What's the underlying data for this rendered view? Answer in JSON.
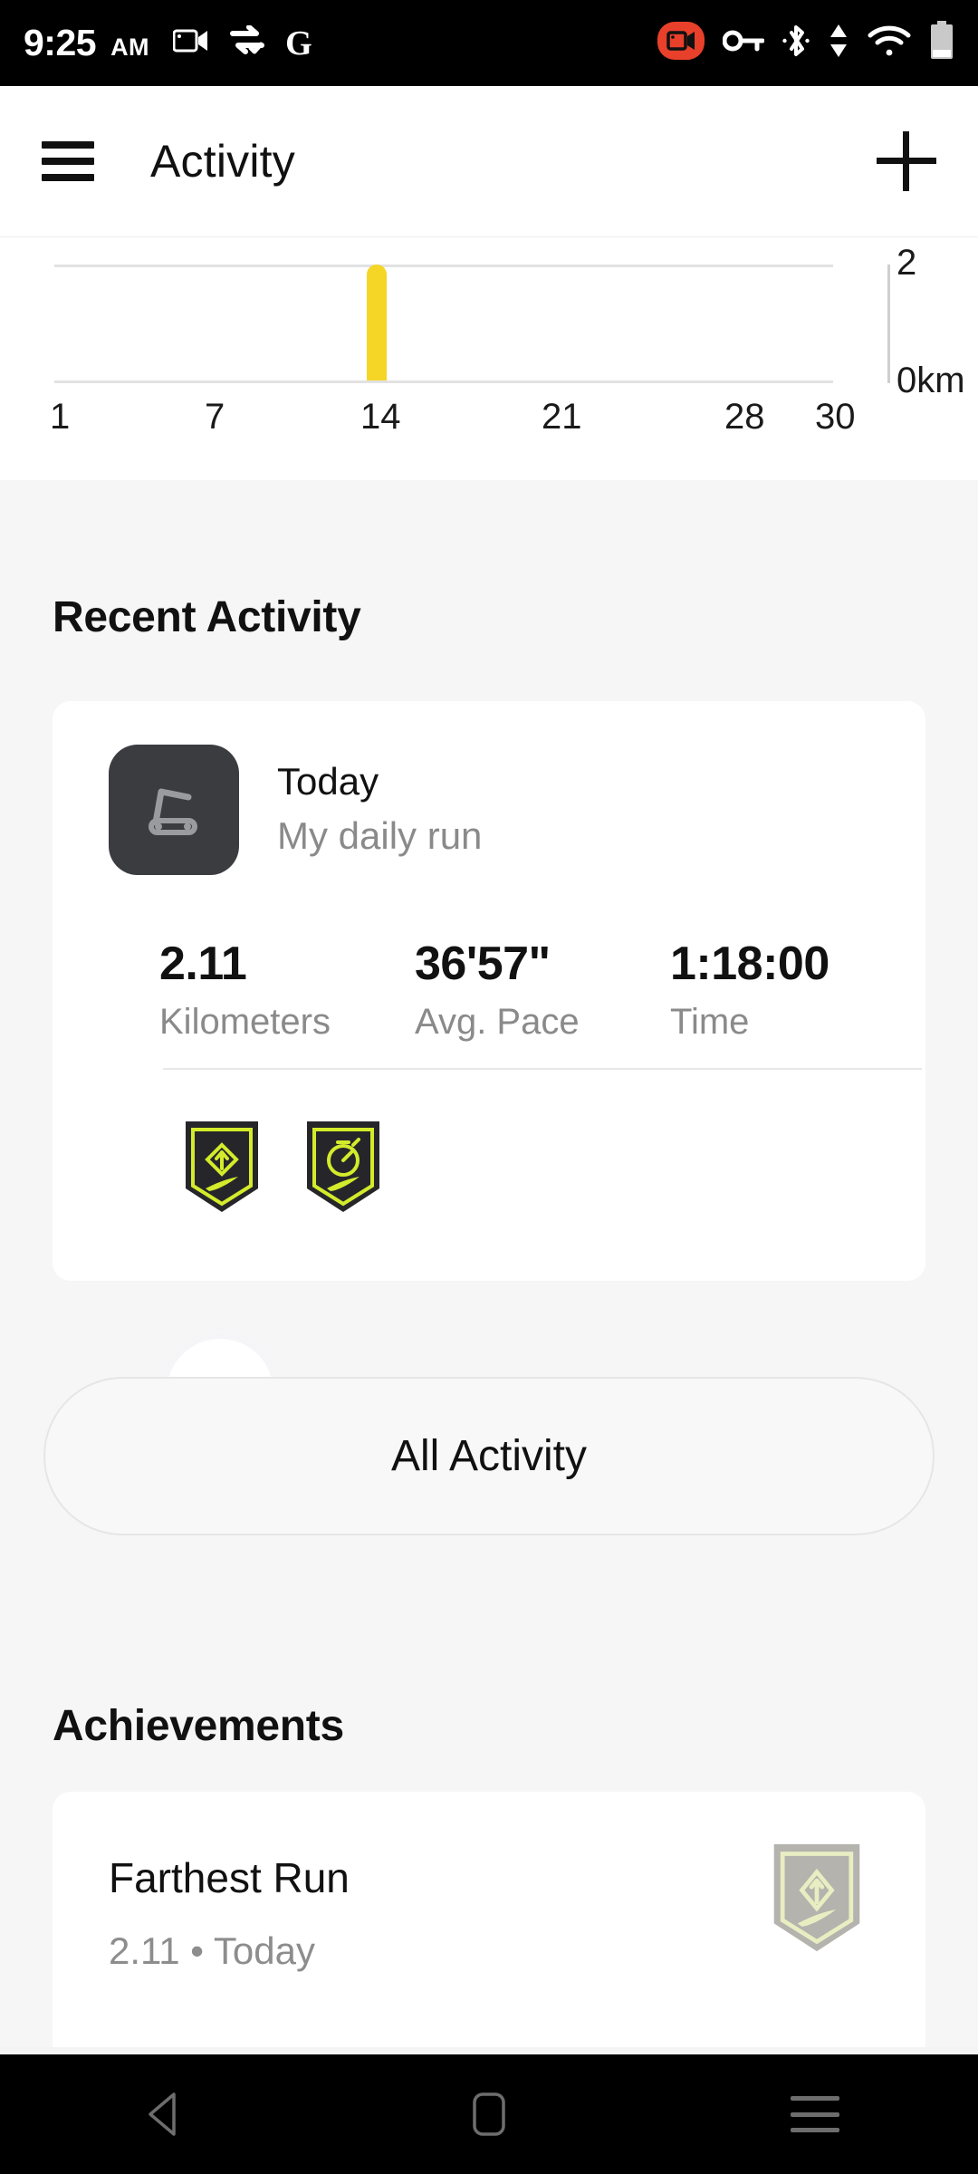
{
  "status_bar": {
    "time": "9:25",
    "ampm": "AM",
    "icons_left": [
      "camcorder-icon",
      "sync-check-icon",
      "google-g-icon"
    ],
    "google_letter": "G",
    "icons_right": [
      "screen-record-icon",
      "vpn-key-icon",
      "bluetooth-icon",
      "data-transfer-icon",
      "wifi-icon",
      "battery-icon"
    ],
    "record_color": "#e8402a"
  },
  "app_bar": {
    "menu_icon": "hamburger-menu-icon",
    "title": "Activity",
    "add_icon": "plus-icon"
  },
  "chart_data": {
    "type": "bar",
    "title": "",
    "xlabel": "",
    "ylabel": "km",
    "categories": [
      "1",
      "7",
      "14",
      "21",
      "28",
      "30"
    ],
    "tick_positions": [
      1,
      7,
      14,
      21,
      28,
      30
    ],
    "x_range": [
      1,
      30
    ],
    "ylim": [
      0,
      2
    ],
    "y_tick_labels": [
      "0km",
      "2"
    ],
    "grid": true,
    "legend": "none",
    "bar_color": "#f5d626",
    "values": [
      {
        "day": 13,
        "value": 2.11
      }
    ],
    "note": "Monthly distance chart, partially scrolled off the top; single bar near day 13 reaching the 2 km gridline"
  },
  "recent": {
    "heading": "Recent Activity",
    "activity": {
      "icon": "treadmill-icon",
      "title": "Today",
      "subtitle": "My daily run",
      "stats": [
        {
          "value": "2.11",
          "label": "Kilometers"
        },
        {
          "value": "36'57\"",
          "label": "Avg. Pace"
        },
        {
          "value": "1:18:00",
          "label": "Time"
        }
      ],
      "badges": [
        {
          "name": "distance-badge",
          "icon": "diamond-arrow-icon"
        },
        {
          "name": "time-badge",
          "icon": "stopwatch-icon"
        }
      ],
      "badge_accent": "#d3eb2b",
      "badge_body": "#26262a"
    },
    "all_activity_label": "All Activity"
  },
  "achievements": {
    "heading": "Achievements",
    "items": [
      {
        "name": "Farthest Run",
        "meta": "2.11 • Today",
        "badge_icon": "diamond-arrow-icon",
        "badge_color": "#b4b3ae"
      }
    ]
  },
  "nav_bar": {
    "back": "back-triangle-icon",
    "home": "home-square-icon",
    "recents": "recents-icon"
  }
}
